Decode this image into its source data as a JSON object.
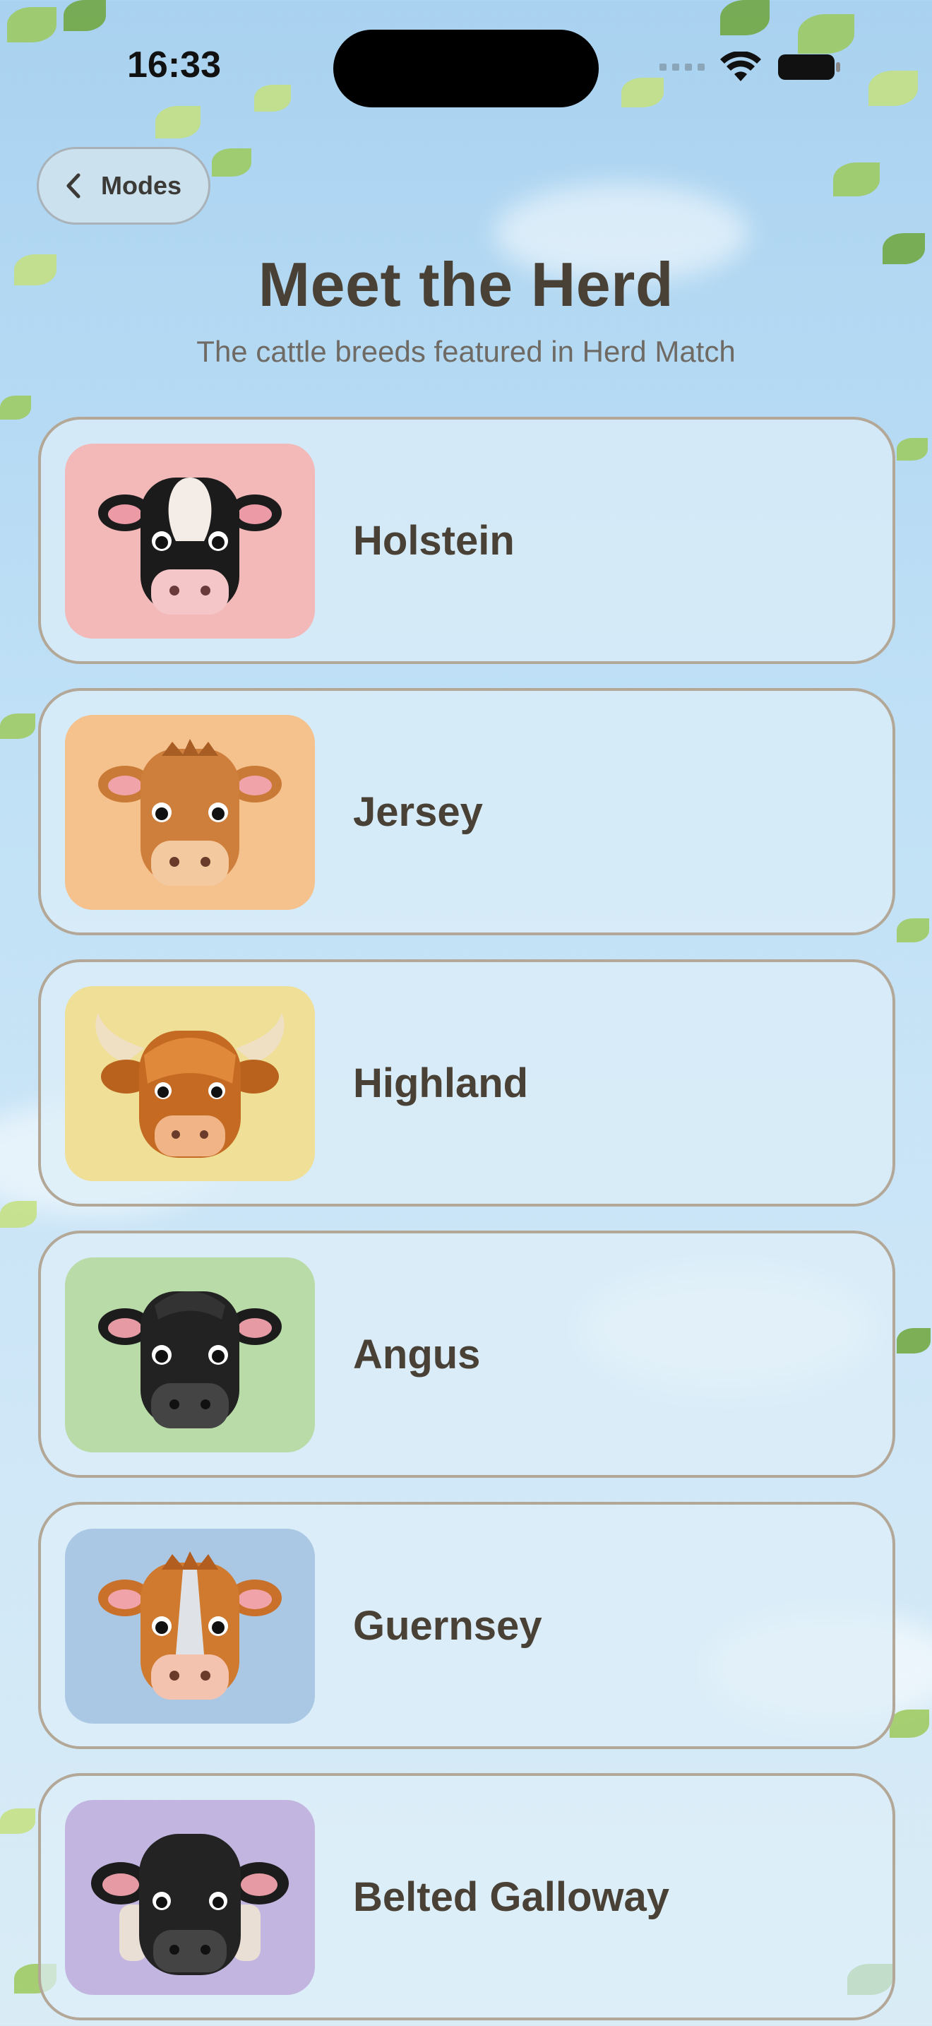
{
  "status_bar": {
    "time": "16:33"
  },
  "nav": {
    "back_label": "Modes"
  },
  "header": {
    "title": "Meet the Herd",
    "subtitle": "The cattle breeds featured in Herd Match"
  },
  "breeds": [
    {
      "name": "Holstein",
      "tile_color": "#f2b9b8",
      "icon": "holstein-cow-icon"
    },
    {
      "name": "Jersey",
      "tile_color": "#f5c18d",
      "icon": "jersey-cow-icon"
    },
    {
      "name": "Highland",
      "tile_color": "#f0df96",
      "icon": "highland-cow-icon"
    },
    {
      "name": "Angus",
      "tile_color": "#b9dba8",
      "icon": "angus-cow-icon"
    },
    {
      "name": "Guernsey",
      "tile_color": "#aac8e4",
      "icon": "guernsey-cow-icon"
    },
    {
      "name": "Belted Galloway",
      "tile_color": "#c2b6e0",
      "icon": "belted-galloway-cow-icon"
    }
  ]
}
